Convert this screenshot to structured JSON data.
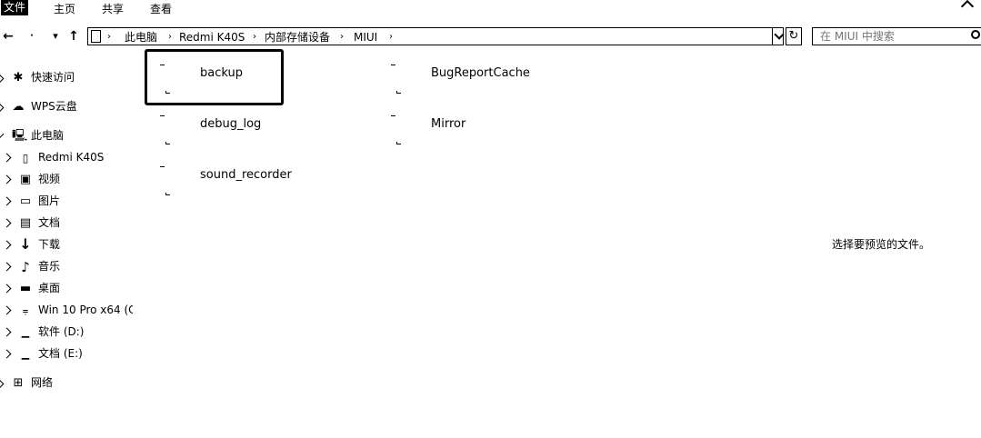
{
  "ribbon": {
    "tabs": [
      {
        "label": "文件",
        "active": true
      },
      {
        "label": "主页",
        "active": false
      },
      {
        "label": "共享",
        "active": false
      },
      {
        "label": "查看",
        "active": false
      }
    ]
  },
  "toolbar": {
    "back_icon": "←",
    "forward_icon": "→",
    "recent_icon": "▾",
    "up_icon": "↑"
  },
  "address": {
    "crumbs": [
      "此电脑",
      "Redmi K40S",
      "内部存储设备",
      "MIUI"
    ],
    "separator": "›"
  },
  "search": {
    "placeholder": "在 MIUI 中搜索"
  },
  "sidebar": {
    "items": [
      {
        "label": "快速访问",
        "icon": "star-icon"
      },
      {
        "label": "WPS云盘",
        "icon": "cloud-icon"
      },
      {
        "label": "此电脑",
        "icon": "computer-icon"
      },
      {
        "label": "Redmi K40S",
        "icon": "phone-icon"
      },
      {
        "label": "视频",
        "icon": "video-icon"
      },
      {
        "label": "图片",
        "icon": "picture-icon"
      },
      {
        "label": "文档",
        "icon": "document-icon"
      },
      {
        "label": "下载",
        "icon": "download-icon"
      },
      {
        "label": "音乐",
        "icon": "music-icon"
      },
      {
        "label": "桌面",
        "icon": "desktop-icon"
      },
      {
        "label": "Win 10 Pro x64 (C",
        "icon": "system-drive-icon"
      },
      {
        "label": "软件 (D:)",
        "icon": "drive-icon"
      },
      {
        "label": "文档 (E:)",
        "icon": "drive-icon"
      },
      {
        "label": "网络",
        "icon": "network-icon"
      }
    ]
  },
  "files": [
    {
      "name": "backup",
      "selected": true
    },
    {
      "name": "BugReportCache",
      "selected": false
    },
    {
      "name": "debug_log",
      "selected": false
    },
    {
      "name": "Mirror",
      "selected": false
    },
    {
      "name": "sound_recorder",
      "selected": false
    }
  ],
  "preview": {
    "message": "选择要预览的文件。"
  }
}
